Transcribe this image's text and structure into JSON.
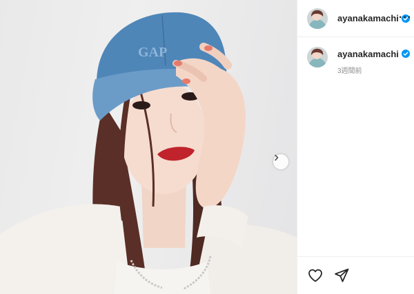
{
  "post": {
    "username": "ayanakamachi",
    "timestamp": "3週間前",
    "cap_text": "GAP"
  },
  "header": {
    "more_label": "···"
  },
  "colors": {
    "verified": "#0095f6",
    "text": "#262626",
    "secondary_text": "#8e8e8e",
    "divider": "#efefef"
  },
  "icons": {
    "more": "more-options-icon",
    "verified": "verified-badge-icon",
    "like": "heart-icon",
    "share": "send-icon",
    "next": "chevron-right-icon"
  }
}
